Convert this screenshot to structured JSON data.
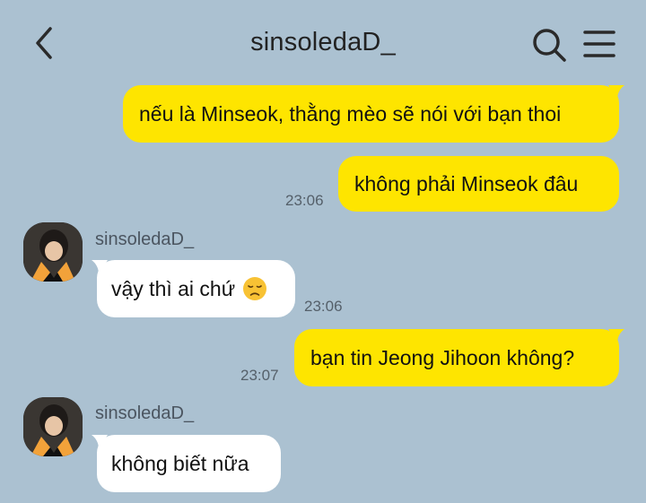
{
  "header": {
    "title": "sinsoledaD_",
    "back_icon": "chevron-left-icon",
    "search_icon": "search-icon",
    "menu_icon": "hamburger-menu-icon"
  },
  "messages": [
    {
      "side": "out",
      "text": "nếu là Minseok, thằng mèo sẽ nói với bạn thoi"
    },
    {
      "side": "out",
      "text": "không phải Minseok đâu",
      "time": "23:06"
    },
    {
      "side": "in",
      "sender": "sinsoledaD_",
      "text": "vậy thì ai chứ",
      "emoji": "disappointed-face-emoji",
      "time": "23:06"
    },
    {
      "side": "out",
      "text": "bạn tin Jeong Jihoon không?",
      "time": "23:07"
    },
    {
      "side": "in",
      "sender": "sinsoledaD_",
      "text": "không biết nữa"
    }
  ],
  "colors": {
    "background": "#abc1d1",
    "outgoing_bubble": "#fee500",
    "incoming_bubble": "#ffffff"
  }
}
